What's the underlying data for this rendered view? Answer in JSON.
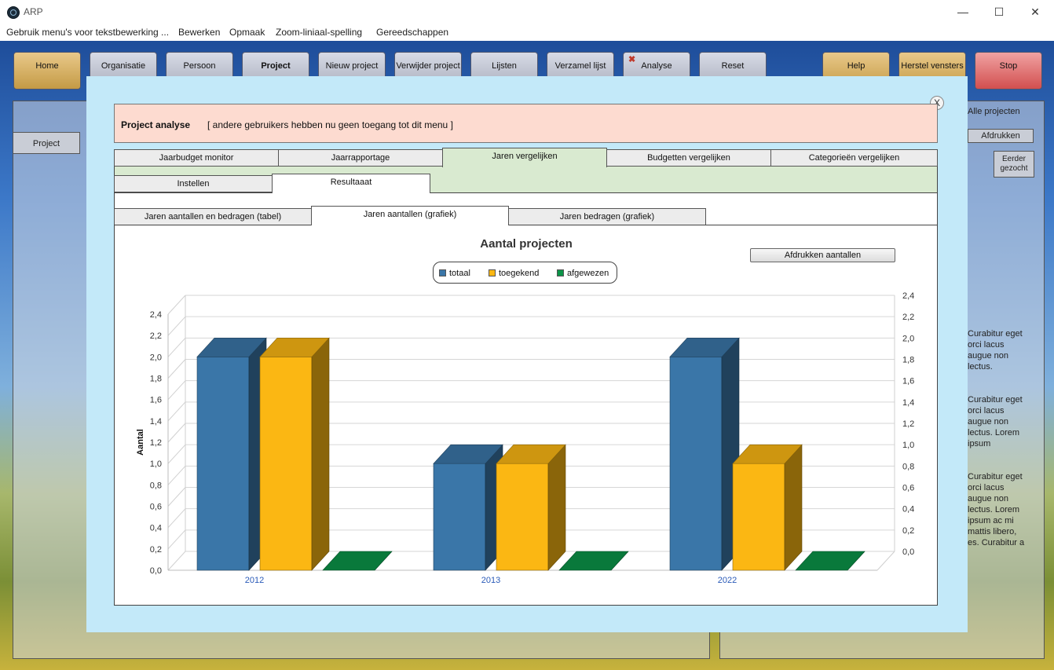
{
  "window": {
    "title": "ARP",
    "minimize": "—",
    "maximize": "☐",
    "close": "✕"
  },
  "menubar": [
    "Gebruik menu's voor tekstbewerking ...",
    "Bewerken",
    "Opmaak",
    "Zoom-liniaal-spelling",
    "Gereedschappen"
  ],
  "toolbar": {
    "home": "Home",
    "organisatie": "Organisatie",
    "persoon": "Persoon",
    "project": "Project",
    "nieuw": "Nieuw project",
    "verwijder": "Verwijder project",
    "lijsten": "Lijsten",
    "verzamel": "Verzamel lijst",
    "analyse": "Analyse",
    "reset": "Reset",
    "help": "Help",
    "herstel": "Herstel vensters",
    "stop": "Stop"
  },
  "background": {
    "project_tab": "Project",
    "alle_projecten": "Alle projecten",
    "afdrukken": "Afdrukken",
    "eerder_gezocht": "Eerder gezocht",
    "text_blocks": [
      "Curabitur eget orci lacus augue non lectus.",
      "Curabitur eget orci lacus augue non lectus. Lorem ipsum",
      "Curabitur eget orci lacus augue non lectus. Lorem ipsum ac mi mattis libero, es. Curabitur a"
    ]
  },
  "modal": {
    "close_label": "X",
    "header_title": "Project analyse",
    "header_sub": "[ andere gebruikers hebben nu geen toegang tot dit menu ]",
    "tabs": [
      "Jaarbudget monitor",
      "Jaarrapportage",
      "Jaren vergelijken",
      "Budgetten vergelijken",
      "Categorieën vergelijken"
    ],
    "subtabs": [
      "Instellen",
      "Resultaaat"
    ],
    "subsubtabs": [
      "Jaren aantallen en bedragen (tabel)",
      "Jaren aantallen (grafiek)",
      "Jaren bedragen (grafiek)"
    ],
    "print_button": "Afdrukken aantallen"
  },
  "chart_data": {
    "type": "bar",
    "title": "Aantal projecten",
    "ylabel": "Aantal",
    "xlabel": "",
    "categories": [
      "2012",
      "2013",
      "2022"
    ],
    "series": [
      {
        "name": "totaal",
        "values": [
          2,
          1,
          2
        ],
        "color": "#3a76a8"
      },
      {
        "name": "toegekend",
        "values": [
          2,
          1,
          1
        ],
        "color": "#fbb713"
      },
      {
        "name": "afgewezen",
        "values": [
          0,
          0,
          0
        ],
        "color": "#0b9448"
      }
    ],
    "ylim": [
      0,
      2.4
    ],
    "yticks": [
      "0,0",
      "0,2",
      "0,4",
      "0,6",
      "0,8",
      "1,0",
      "1,2",
      "1,4",
      "1,6",
      "1,8",
      "2,0",
      "2,2",
      "2,4"
    ],
    "grid": true,
    "legend_position": "top",
    "three_d": true
  }
}
